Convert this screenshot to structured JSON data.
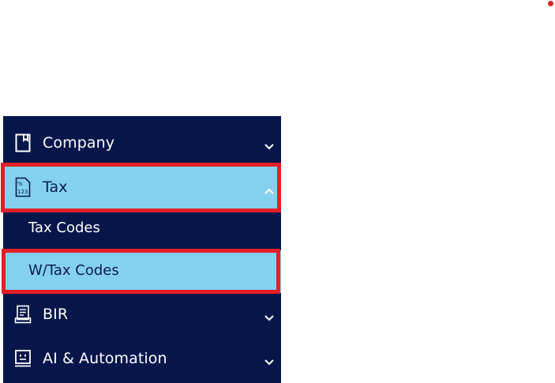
{
  "sidebar": {
    "items": [
      {
        "label": "Company",
        "icon": "bookmark-icon",
        "expanded": false
      },
      {
        "label": "Tax",
        "icon": "tax-document-icon",
        "expanded": true,
        "children": [
          {
            "label": "Tax Codes",
            "selected": false
          },
          {
            "label": "W/Tax Codes",
            "selected": true
          }
        ]
      },
      {
        "label": "BIR",
        "icon": "bir-form-icon",
        "expanded": false
      },
      {
        "label": "AI & Automation",
        "icon": "robot-face-icon",
        "expanded": false
      }
    ]
  },
  "colors": {
    "sidebar_bg": "#06164a",
    "highlight_bg": "#84d1ef",
    "annotation_red": "#e41f26"
  }
}
